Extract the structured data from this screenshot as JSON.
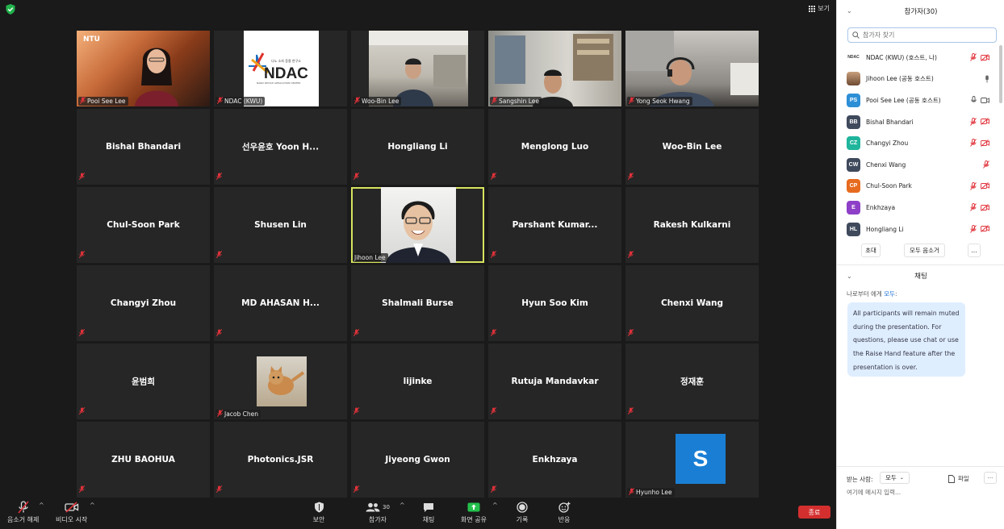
{
  "topbar": {
    "view_label": "보기"
  },
  "tiles": [
    {
      "name": "Pooi See Lee",
      "type": "video",
      "scene": "ntu"
    },
    {
      "name": "NDAC (KWU)",
      "type": "video",
      "scene": "ndac"
    },
    {
      "name": "Woo-Bin Lee",
      "type": "video",
      "scene": "lab1"
    },
    {
      "name": "Sangshin Lee",
      "type": "video",
      "scene": "lab2"
    },
    {
      "name": "Yong Seok Hwang",
      "type": "video",
      "scene": "lab3"
    },
    {
      "name": "Bishal Bhandari",
      "type": "name"
    },
    {
      "name": "선우윤호 Yoon H...",
      "type": "name"
    },
    {
      "name": "Hongliang Li",
      "type": "name"
    },
    {
      "name": "Menglong Luo",
      "type": "name"
    },
    {
      "name": "Woo-Bin Lee",
      "type": "name"
    },
    {
      "name": "Chul-Soon Park",
      "type": "name"
    },
    {
      "name": "Shusen Lin",
      "type": "name"
    },
    {
      "name": "Jihoon Lee",
      "type": "video",
      "scene": "jihoon",
      "speaking": true
    },
    {
      "name": "Parshant  Kumar...",
      "type": "name"
    },
    {
      "name": "Rakesh Kulkarni",
      "type": "name"
    },
    {
      "name": "Changyi Zhou",
      "type": "name"
    },
    {
      "name": "MD  AHASAN  H...",
      "type": "name"
    },
    {
      "name": "Shalmali Burse",
      "type": "name"
    },
    {
      "name": "Hyun Soo Kim",
      "type": "name"
    },
    {
      "name": "Chenxi Wang",
      "type": "name"
    },
    {
      "name": "윤범희",
      "type": "name"
    },
    {
      "name": "Jacob Chen",
      "type": "video",
      "scene": "cat"
    },
    {
      "name": "lijinke",
      "type": "name"
    },
    {
      "name": "Rutuja Mandavkar",
      "type": "name"
    },
    {
      "name": "정재훈",
      "type": "name"
    },
    {
      "name": "ZHU BAOHUA",
      "type": "name"
    },
    {
      "name": "Photonics.JSR",
      "type": "name"
    },
    {
      "name": "Jiyeong Gwon",
      "type": "name"
    },
    {
      "name": "Enkhzaya",
      "type": "name"
    },
    {
      "name": "Hyunho Lee",
      "type": "video",
      "scene": "s",
      "avatar_letter": "S"
    }
  ],
  "ntu_logo": "NTU",
  "ndac_logo": {
    "main": "NDAC",
    "kor": "나노 소자 응용 연구소",
    "eng": "NANO DEVICE APPLICATION CENTER"
  },
  "toolbar": {
    "unmute": "음소거 해제",
    "start_video": "비디오 시작",
    "security": "보안",
    "participants": "참가자",
    "participants_count": "30",
    "chat": "채팅",
    "share": "화면 공유",
    "record": "기록",
    "reactions": "반응",
    "end": "종료"
  },
  "participants_panel": {
    "title": "참가자(30)",
    "search_placeholder": "참가자 찾기",
    "rows": [
      {
        "initials": "NDAC",
        "name": "NDAC (KWU) (호스트, 나)",
        "avatar": "logo",
        "color": "#ffffff",
        "icons": [
          "mic-off",
          "video-off"
        ]
      },
      {
        "initials": "",
        "name": "Jihoon Lee (공동 호스트)",
        "avatar": "face",
        "color": "#8a6045",
        "icons": [
          "mic-on"
        ]
      },
      {
        "initials": "PS",
        "name": "Pooi See Lee (공동 호스트)",
        "avatar": "text",
        "color": "#2d8fd6",
        "icons": [
          "mic-on-outline",
          "video-on"
        ]
      },
      {
        "initials": "BB",
        "name": "Bishal Bhandari",
        "avatar": "text",
        "color": "#3f4a5c",
        "icons": [
          "mic-off",
          "video-off"
        ]
      },
      {
        "initials": "CZ",
        "name": "Changyi Zhou",
        "avatar": "text",
        "color": "#1fb59c",
        "icons": [
          "mic-off",
          "video-off"
        ]
      },
      {
        "initials": "CW",
        "name": "Chenxi Wang",
        "avatar": "text",
        "color": "#3f4a5c",
        "icons": [
          "mic-off"
        ]
      },
      {
        "initials": "CP",
        "name": "Chul-Soon Park",
        "avatar": "text",
        "color": "#e76b1f",
        "icons": [
          "mic-off",
          "video-off"
        ]
      },
      {
        "initials": "E",
        "name": "Enkhzaya",
        "avatar": "text",
        "color": "#8d3fc7",
        "icons": [
          "mic-off",
          "video-off"
        ]
      },
      {
        "initials": "HL",
        "name": "Hongliang Li",
        "avatar": "text",
        "color": "#3f4a5c",
        "icons": [
          "mic-off",
          "video-off"
        ]
      }
    ],
    "invite": "초대",
    "mute_all": "모두 음소거",
    "more": "..."
  },
  "chat_panel": {
    "title": "채팅",
    "from_prefix": "나로부터 에게",
    "from_to": "모두",
    "from_suffix": ":",
    "message": "All participants will remain muted during the presentation. For questions, please use chat or use the Raise Hand feature after the presentation is over.",
    "recipient_label": "받는 사람:",
    "recipient_value": "모두",
    "file_label": "파일",
    "more": "···",
    "input_placeholder": "여기에 메시지 입력..."
  },
  "colors": {
    "mic_off_red": "#e0323a",
    "speaking_outline": "#d7e35f",
    "share_green": "#23c14c",
    "end_red": "#d42f2f",
    "link_blue": "#1a6fd4"
  }
}
